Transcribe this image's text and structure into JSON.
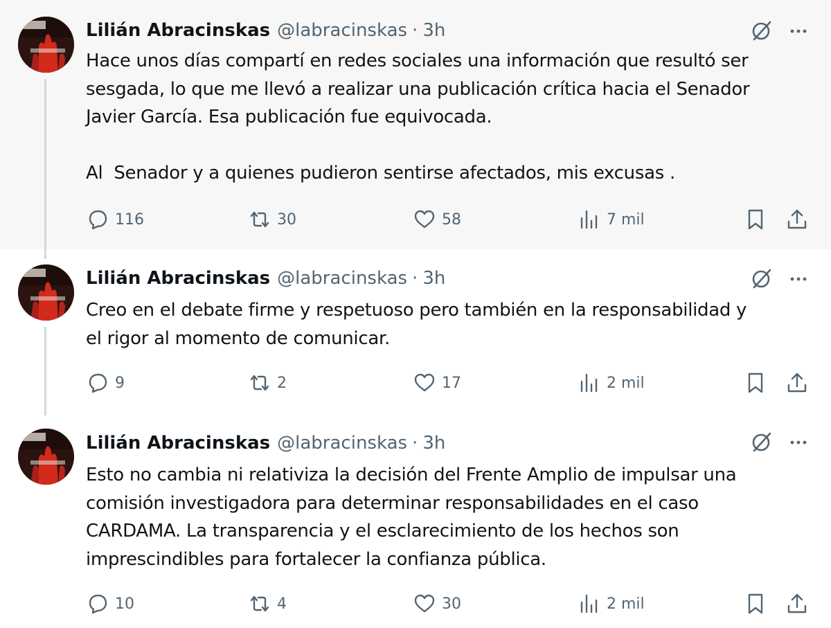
{
  "tweets": [
    {
      "name": "Lilián Abracinskas",
      "handle": "@labracinskas",
      "separator": "·",
      "time": "3h",
      "text": "Hace unos días compartí en redes sociales una información que resultó ser\nsesgada, lo que me llevó a realizar una publicación crítica hacia el Senador\nJavier García. Esa publicación fue equivocada.\n\nAl  Senador y a quienes pudieron sentirse afectados, mis excusas .",
      "replies": "116",
      "retweets": "30",
      "likes": "58",
      "views": "7 mil"
    },
    {
      "name": "Lilián Abracinskas",
      "handle": "@labracinskas",
      "separator": "·",
      "time": "3h",
      "text": "Creo en el debate firme y respetuoso pero también en la responsabilidad y\nel rigor al momento de comunicar.",
      "replies": "9",
      "retweets": "2",
      "likes": "17",
      "views": "2 mil"
    },
    {
      "name": "Lilián Abracinskas",
      "handle": "@labracinskas",
      "separator": "·",
      "time": "3h",
      "text": "Esto no cambia ni relativiza la decisión del Frente Amplio de impulsar una\ncomisión investigadora para determinar responsabilidades en el caso\nCARDAMA. La transparencia y el esclarecimiento de los hechos son\nimprescindibles para fortalecer la confianza pública.",
      "replies": "10",
      "retweets": "4",
      "likes": "30",
      "views": "2 mil"
    }
  ],
  "icons": {
    "grok": "grok-icon",
    "more": "more-icon",
    "reply": "reply-icon",
    "retweet": "retweet-icon",
    "like": "heart-icon",
    "views": "views-icon",
    "bookmark": "bookmark-icon",
    "share": "share-icon"
  },
  "colors": {
    "text": "#0f1419",
    "secondary": "#536471",
    "highlight_bg": "#f7f7f7",
    "thread_line": "#cfd9de"
  }
}
